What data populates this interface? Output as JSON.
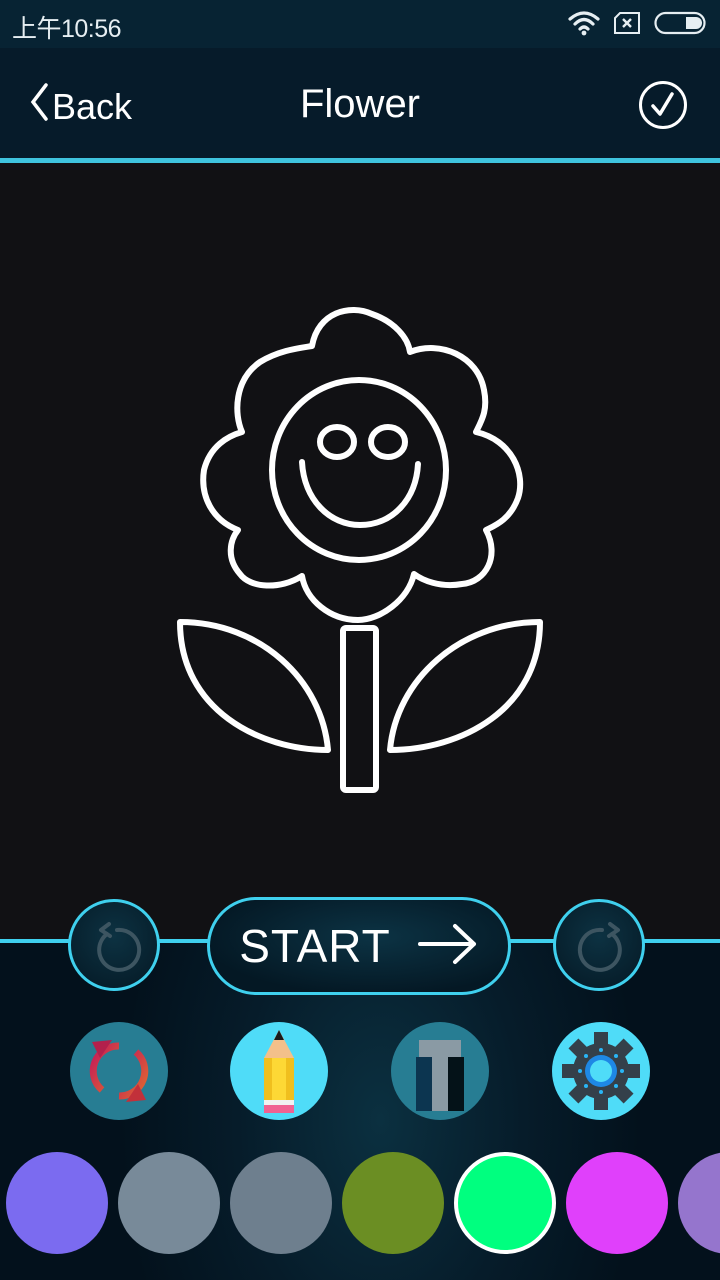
{
  "status_bar": {
    "time": "上午10:56",
    "icons": [
      "wifi-icon",
      "no-sim-icon",
      "battery-icon"
    ]
  },
  "header": {
    "back_label": "Back",
    "title": "Flower",
    "confirm_icon": "check-circle-icon"
  },
  "canvas": {
    "drawing": "flower-with-smiley-face-outline",
    "stroke_color": "#ffffff",
    "background": "#111114"
  },
  "controls": {
    "undo_icon": "undo-icon",
    "start_label": "START",
    "start_icon": "arrow-right-icon",
    "redo_icon": "redo-icon"
  },
  "tools": [
    {
      "name": "refresh",
      "icon": "refresh-icon",
      "active": false
    },
    {
      "name": "pencil",
      "icon": "pencil-icon",
      "active": true
    },
    {
      "name": "text",
      "icon": "text-tool-icon",
      "active": false
    },
    {
      "name": "settings",
      "icon": "gear-icon",
      "active": true
    }
  ],
  "palette": {
    "colors": [
      "#7b6bf0",
      "#788a99",
      "#6e7f8e",
      "#6b8e23",
      "#00ff7f",
      "#e040fb",
      "#9575cd"
    ],
    "selected_index": 4
  },
  "theme": {
    "accent": "#3fd0ee",
    "header_bg": "#061b2a",
    "status_bg": "#072333"
  }
}
